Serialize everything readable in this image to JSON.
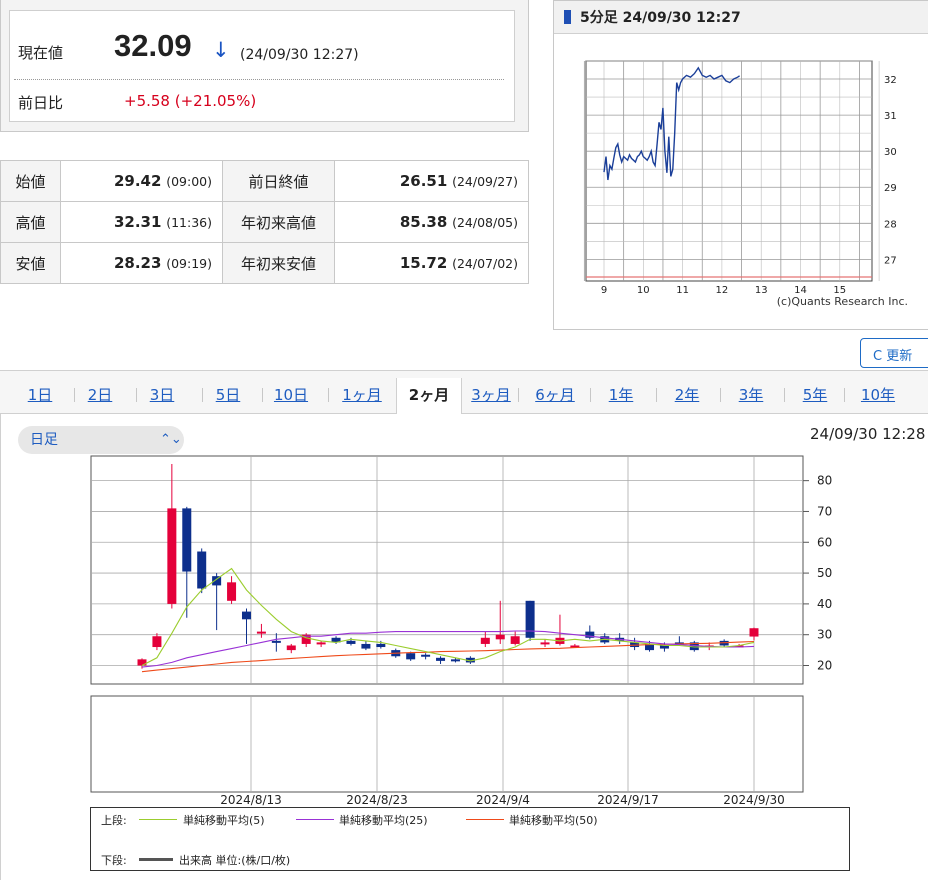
{
  "quote": {
    "label": "現在値",
    "value": "32.09",
    "arrow": "↓",
    "time": "(24/09/30 12:27)",
    "change_label": "前日比",
    "change_value": "+5.58 (+21.05%)"
  },
  "stats": [
    {
      "label": "始値",
      "value": "29.42",
      "time": "(09:00)",
      "label2": "前日終値",
      "value2": "26.51",
      "time2": "(24/09/27)"
    },
    {
      "label": "高値",
      "value": "32.31",
      "time": "(11:36)",
      "label2": "年初来高値",
      "value2": "85.38",
      "time2": "(24/08/05)"
    },
    {
      "label": "安値",
      "value": "28.23",
      "time": "(09:19)",
      "label2": "年初来安値",
      "value2": "15.72",
      "time2": "(24/07/02)"
    }
  ],
  "intraday": {
    "title": "5分足 24/09/30 12:27",
    "credit": "(c)Quants Research Inc."
  },
  "refresh_label": "C 更新",
  "tabs": [
    "1日",
    "2日",
    "3日",
    "5日",
    "10日",
    "1ヶ月",
    "2ヶ月",
    "3ヶ月",
    "6ヶ月",
    "1年",
    "2年",
    "3年",
    "5年",
    "10年"
  ],
  "active_tab": "2ヶ月",
  "interval": {
    "selected": "日足"
  },
  "daily_time": "24/09/30 12:28",
  "legend": {
    "upper_label": "上段:",
    "ma5": "単純移動平均(5)",
    "ma25": "単純移動平均(25)",
    "ma50": "単純移動平均(50)",
    "lower_label": "下段:",
    "volume": "出来高 単位:(株/口/枚)"
  },
  "colors": {
    "up": "#e4003a",
    "down": "#0d2f8c",
    "ma5": "#9bcd2e",
    "ma25": "#9932d6",
    "ma50": "#ef4a1a",
    "line": "#1b3f99"
  },
  "chart_data": [
    {
      "type": "line",
      "title": "5分足 24/09/30 12:27",
      "x_ticks": [
        "9",
        "10",
        "11",
        "12",
        "13",
        "14",
        "15"
      ],
      "y_ticks": [
        27,
        28,
        29,
        30,
        31,
        32
      ],
      "xlim": [
        9,
        15.5
      ],
      "ylim": [
        26.4,
        32.5
      ],
      "reference_line": 26.51,
      "x": [
        9.0,
        9.05,
        9.1,
        9.15,
        9.2,
        9.25,
        9.3,
        9.35,
        9.4,
        9.45,
        9.5,
        9.55,
        9.6,
        9.65,
        9.7,
        9.75,
        9.8,
        9.85,
        9.9,
        9.95,
        10.0,
        10.05,
        10.1,
        10.15,
        10.2,
        10.25,
        10.3,
        10.35,
        10.4,
        10.45,
        10.5,
        10.55,
        10.6,
        10.65,
        10.7,
        10.75,
        10.8,
        10.85,
        10.9,
        10.95,
        11.0,
        11.1,
        11.2,
        11.3,
        11.4,
        11.5,
        11.6,
        11.7,
        11.8,
        11.9,
        12.0,
        12.1,
        12.2,
        12.3,
        12.4,
        12.45
      ],
      "y": [
        29.42,
        29.85,
        29.2,
        29.6,
        29.5,
        29.8,
        30.1,
        30.2,
        29.9,
        29.7,
        29.85,
        29.8,
        29.75,
        29.9,
        29.8,
        29.75,
        29.7,
        29.85,
        29.9,
        30.0,
        29.85,
        29.8,
        29.75,
        29.85,
        30.0,
        29.7,
        29.6,
        30.2,
        30.8,
        30.6,
        31.2,
        30.0,
        29.4,
        30.4,
        29.3,
        29.5,
        30.5,
        31.9,
        31.7,
        31.9,
        32.0,
        32.1,
        32.05,
        32.15,
        32.31,
        32.1,
        32.05,
        32.1,
        32.0,
        32.05,
        32.1,
        31.95,
        31.9,
        32.0,
        32.05,
        32.09
      ]
    },
    {
      "type": "candlestick",
      "title": "",
      "x_ticks": [
        "2024/8/13",
        "2024/8/23",
        "2024/9/4",
        "2024/9/17",
        "2024/9/30"
      ],
      "y_ticks": [
        20,
        30,
        40,
        50,
        60,
        70,
        80
      ],
      "ylim": [
        14,
        88
      ],
      "candles": [
        {
          "o": 20.0,
          "h": 22.3,
          "l": 19.0,
          "c": 22.0
        },
        {
          "o": 26.0,
          "h": 30.5,
          "l": 25.0,
          "c": 29.5
        },
        {
          "o": 40.0,
          "h": 85.4,
          "l": 38.5,
          "c": 71.0
        },
        {
          "o": 71.0,
          "h": 71.5,
          "l": 35.5,
          "c": 50.5
        },
        {
          "o": 57.0,
          "h": 58.0,
          "l": 43.5,
          "c": 45.0
        },
        {
          "o": 49.0,
          "h": 50.0,
          "l": 31.5,
          "c": 46.0
        },
        {
          "o": 41.0,
          "h": 49.0,
          "l": 40.0,
          "c": 47.0
        },
        {
          "o": 37.5,
          "h": 38.5,
          "l": 27.0,
          "c": 35.0
        },
        {
          "o": 30.5,
          "h": 33.5,
          "l": 29.0,
          "c": 31.0
        },
        {
          "o": 28.0,
          "h": 30.5,
          "l": 24.5,
          "c": 27.5
        },
        {
          "o": 25.0,
          "h": 27.0,
          "l": 24.0,
          "c": 26.5
        },
        {
          "o": 27.0,
          "h": 30.5,
          "l": 26.0,
          "c": 30.0
        },
        {
          "o": 27.0,
          "h": 28.0,
          "l": 26.0,
          "c": 27.5
        },
        {
          "o": 29.0,
          "h": 29.5,
          "l": 27.0,
          "c": 27.5
        },
        {
          "o": 28.0,
          "h": 29.0,
          "l": 26.5,
          "c": 27.0
        },
        {
          "o": 27.0,
          "h": 28.0,
          "l": 25.0,
          "c": 25.5
        },
        {
          "o": 27.0,
          "h": 28.0,
          "l": 25.5,
          "c": 26.0
        },
        {
          "o": 25.0,
          "h": 25.5,
          "l": 22.5,
          "c": 23.0
        },
        {
          "o": 24.0,
          "h": 24.5,
          "l": 21.5,
          "c": 22.0
        },
        {
          "o": 23.5,
          "h": 24.0,
          "l": 22.0,
          "c": 23.0
        },
        {
          "o": 22.5,
          "h": 23.0,
          "l": 20.5,
          "c": 21.5
        },
        {
          "o": 22.0,
          "h": 22.5,
          "l": 21.0,
          "c": 21.5
        },
        {
          "o": 22.5,
          "h": 23.0,
          "l": 20.5,
          "c": 21.0
        },
        {
          "o": 27.0,
          "h": 31.0,
          "l": 26.0,
          "c": 29.0
        },
        {
          "o": 28.5,
          "h": 41.0,
          "l": 27.0,
          "c": 30.0
        },
        {
          "o": 27.0,
          "h": 31.0,
          "l": 26.5,
          "c": 29.5
        },
        {
          "o": 41.0,
          "h": 41.0,
          "l": 28.0,
          "c": 29.0
        },
        {
          "o": 27.0,
          "h": 28.5,
          "l": 26.0,
          "c": 27.5
        },
        {
          "o": 27.0,
          "h": 36.5,
          "l": 26.5,
          "c": 29.0
        },
        {
          "o": 26.5,
          "h": 27.0,
          "l": 26.0,
          "c": 26.5
        },
        {
          "o": 31.0,
          "h": 33.0,
          "l": 28.5,
          "c": 29.0
        },
        {
          "o": 29.5,
          "h": 30.5,
          "l": 27.0,
          "c": 27.5
        },
        {
          "o": 29.0,
          "h": 30.5,
          "l": 27.0,
          "c": 28.0
        },
        {
          "o": 27.5,
          "h": 29.0,
          "l": 25.0,
          "c": 26.0
        },
        {
          "o": 27.0,
          "h": 28.0,
          "l": 24.5,
          "c": 25.0
        },
        {
          "o": 26.5,
          "h": 27.5,
          "l": 24.5,
          "c": 25.5
        },
        {
          "o": 27.5,
          "h": 29.5,
          "l": 26.5,
          "c": 27.0
        },
        {
          "o": 27.5,
          "h": 28.0,
          "l": 24.5,
          "c": 25.0
        },
        {
          "o": 26.0,
          "h": 27.5,
          "l": 25.0,
          "c": 26.5
        },
        {
          "o": 28.0,
          "h": 28.5,
          "l": 26.0,
          "c": 26.5
        },
        {
          "o": 26.5,
          "h": 27.0,
          "l": 26.0,
          "c": 26.5
        },
        {
          "o": 29.4,
          "h": 32.3,
          "l": 28.2,
          "c": 32.1
        }
      ],
      "ma5": [
        20.0,
        22.5,
        30.5,
        39.0,
        44.5,
        48.0,
        51.5,
        44.5,
        39.5,
        35.0,
        31.0,
        29.0,
        28.0,
        27.5,
        28.5,
        28.0,
        27.5,
        26.5,
        25.5,
        24.5,
        23.5,
        22.5,
        21.5,
        22.5,
        24.5,
        26.0,
        28.5,
        28.5,
        28.0,
        28.5,
        28.0,
        28.5,
        28.0,
        27.5,
        27.0,
        26.5,
        26.5,
        26.0,
        26.0,
        26.0,
        26.5,
        27.5
      ],
      "ma25": [
        19.5,
        20.0,
        21.0,
        22.5,
        23.5,
        24.5,
        25.5,
        26.5,
        27.5,
        28.5,
        29.0,
        29.5,
        29.5,
        30.0,
        30.5,
        30.5,
        30.8,
        31.0,
        31.0,
        31.0,
        31.0,
        31.0,
        31.0,
        31.0,
        31.0,
        31.2,
        31.2,
        31.0,
        30.5,
        30.0,
        29.5,
        29.0,
        28.5,
        28.0,
        27.5,
        27.0,
        26.8,
        26.5,
        26.2,
        26.0,
        26.0,
        26.2
      ],
      "ma50": [
        18.0,
        18.5,
        19.0,
        19.5,
        20.0,
        20.5,
        21.0,
        21.3,
        21.6,
        22.0,
        22.3,
        22.6,
        22.9,
        23.2,
        23.4,
        23.6,
        23.8,
        24.0,
        24.2,
        24.3,
        24.5,
        24.6,
        24.7,
        24.8,
        25.0,
        25.2,
        25.4,
        25.5,
        25.6,
        25.8,
        26.0,
        26.2,
        26.4,
        26.6,
        26.8,
        26.9,
        27.0,
        27.1,
        27.2,
        27.4,
        27.6,
        27.8
      ]
    }
  ]
}
